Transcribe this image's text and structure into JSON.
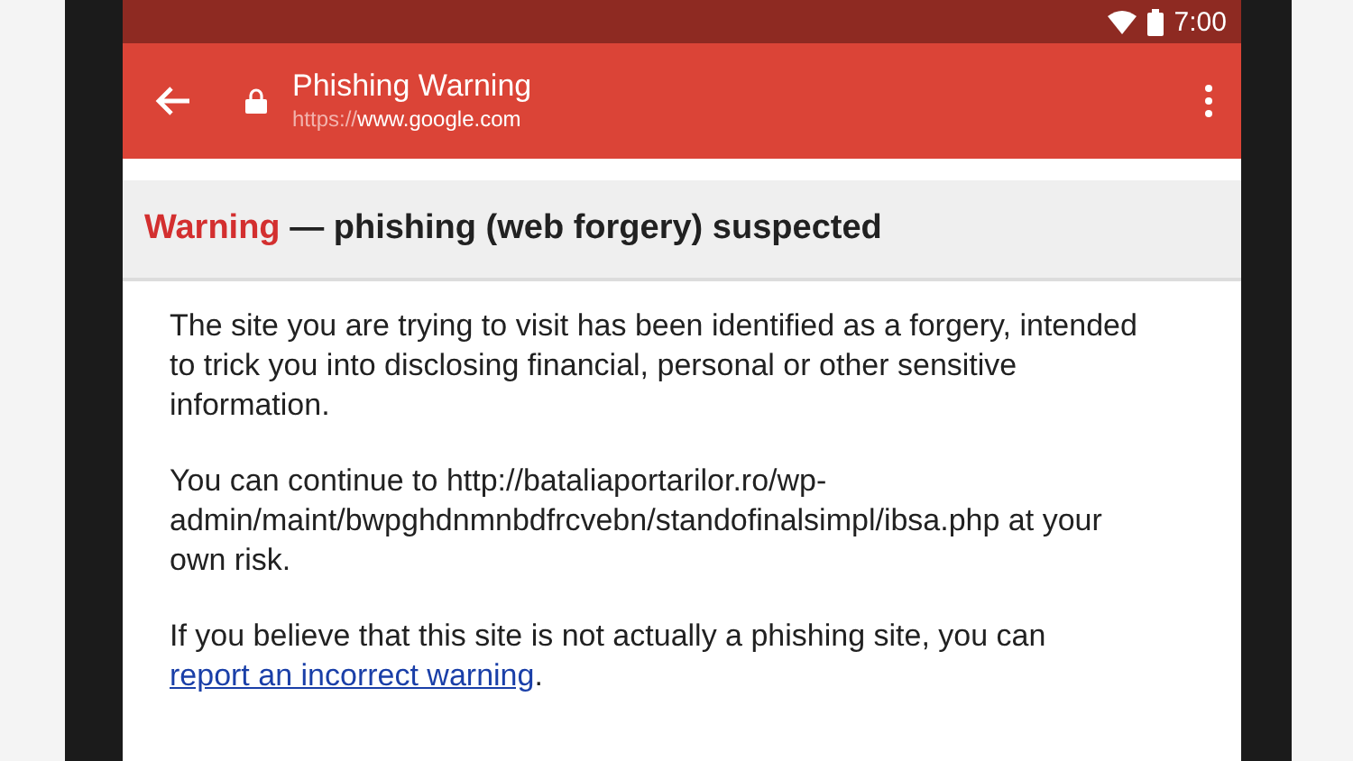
{
  "status_bar": {
    "time": "7:00"
  },
  "toolbar": {
    "title": "Phishing Warning",
    "url_scheme": "https://",
    "url_host": "www.google.com"
  },
  "warning": {
    "label": "Warning",
    "heading": " — phishing (web forgery) suspected"
  },
  "paragraphs": [
    {
      "kind": "text",
      "text": "The site you are trying to visit has been identified as a forgery, intended to trick you into disclosing financial, personal or other sensitive information."
    },
    {
      "kind": "text",
      "text": "You can continue to http://bataliaportarilor.ro/wp-admin/maint/bwpghdnmnbdfrcvebn/standofinalsimpl/ibsa.php at your own risk."
    },
    {
      "kind": "link",
      "text": "If you believe that this site is not actually a phishing site, you can ",
      "link": "report an incorrect warning",
      "after": "."
    }
  ]
}
